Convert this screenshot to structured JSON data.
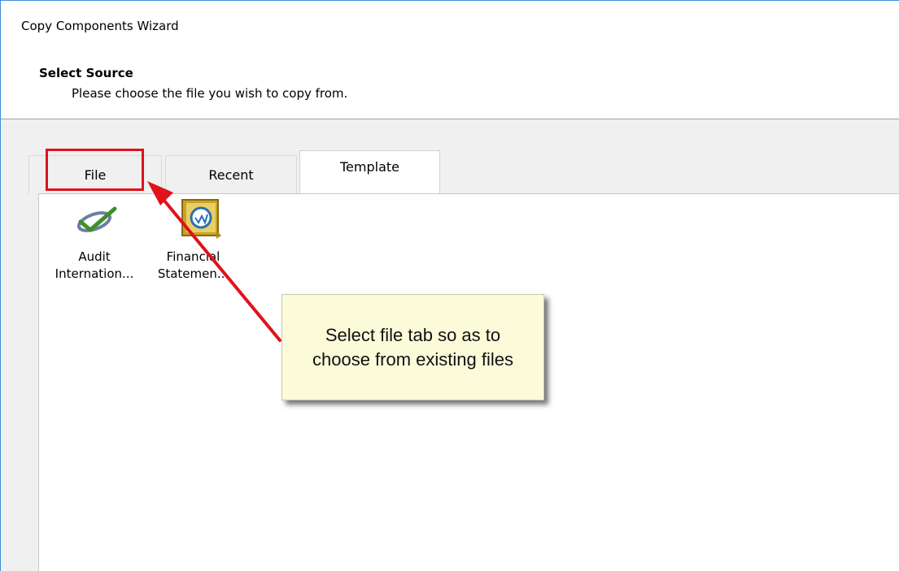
{
  "window": {
    "title": "Copy Components Wizard"
  },
  "header": {
    "section_title": "Select Source",
    "section_description": "Please choose the file you wish to copy from."
  },
  "tabs": [
    {
      "label": "File",
      "active": false
    },
    {
      "label": "Recent",
      "active": false
    },
    {
      "label": "Template",
      "active": true
    }
  ],
  "templates": [
    {
      "name_line1": "Audit",
      "name_line2": "Internation...",
      "icon": "audit-checkmark-icon"
    },
    {
      "name_line1": "Financial",
      "name_line2": "Statemen...",
      "icon": "financial-statement-icon"
    }
  ],
  "annotation": {
    "text": "Select file tab so as to choose from existing files",
    "highlight_color": "#e0121b",
    "callout_color": "#fbfbd9"
  },
  "colors": {
    "window_border": "#3b8ed6",
    "panel_background": "#f0f0f0"
  }
}
